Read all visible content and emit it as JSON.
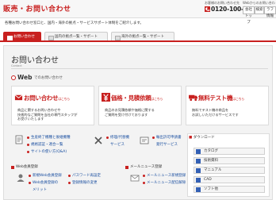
{
  "header": {
    "title": "販売・お問い合わせ",
    "hours_label": "お客様のお問い合わせ先",
    "phone": "0120-100-470",
    "web_contact_label": "Webからのお問い合わせ",
    "buttons": [
      "会社トップ",
      "検索",
      "ラフ情報"
    ]
  },
  "intro": "各種お問い合わせ窓口と、国内・海外の拠点・サービスサポート体制をご紹介します。",
  "tabs": [
    {
      "label": "お問い合わせ",
      "active": true
    },
    {
      "label": "国内の拠点一覧・サポート",
      "active": false
    },
    {
      "label": "海外の拠点一覧・サポート",
      "active": false
    }
  ],
  "section": {
    "title": "お問い合わせ",
    "subtitle": "Contact"
  },
  "web": {
    "big": "Web",
    "small": "でのお問い合わせ"
  },
  "cards": [
    {
      "title": "お問い合わせ",
      "here": "はこちら",
      "desc": [
        "商品に関するお問い合わせや",
        "技術的なご質問を当社の専門スタッフが",
        "お受けいたします"
      ]
    },
    {
      "title": "価格・見積依頼",
      "here": "はこちら",
      "desc": [
        "商品のお見積依頼や価格に関する",
        "ご質問を受け付けております"
      ]
    },
    {
      "title": "無料テスト機",
      "here": "はこちら",
      "desc": [
        "無料でテスト機の商品を",
        "お試しいただけるサービスです"
      ]
    }
  ],
  "row1": {
    "col1": [
      "生産終了機種と後継機種",
      "規格認証・適合一覧",
      "サイトの使い方(Q&A)"
    ],
    "col2": [
      "修理/代替機",
      "サービス"
    ],
    "col3": [
      "輸出許可申請書",
      "発行サービス"
    ]
  },
  "row2": {
    "web_member_title": "Web会員登録",
    "news_title": "メールニュース登録",
    "col1": [
      "新規Web会員登録",
      "Web会員登録の",
      "メリット"
    ],
    "col2": [
      "パスワード再設定",
      "登録情報の変更"
    ],
    "col3": [
      "メールニュース新規登録",
      "メールニュース配信解除"
    ]
  },
  "download": {
    "title": "ダウンロード",
    "items": [
      "カタログ",
      "技術資料",
      "マニュアル",
      "CAD",
      "ソフト他"
    ]
  },
  "colors": {
    "accent": "#c8201f",
    "link": "#1a4fa0",
    "download_icon": "#3360b5"
  }
}
